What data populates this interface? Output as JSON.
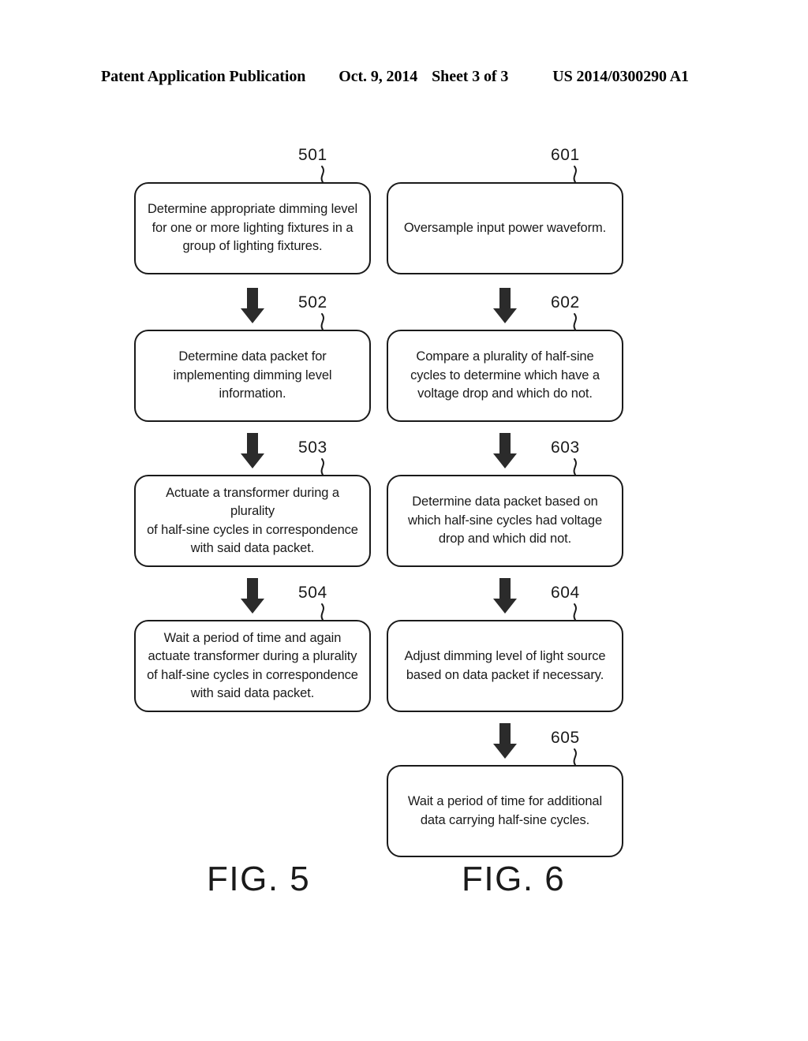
{
  "header": {
    "publication": "Patent Application Publication",
    "date": "Oct. 9, 2014",
    "sheet": "Sheet 3 of 3",
    "doc_number": "US 2014/0300290 A1"
  },
  "figures": [
    {
      "caption": "FIG. 5",
      "steps": [
        {
          "ref": "501",
          "text": "Determine appropriate dimming level\nfor one or more lighting fixtures in a\ngroup of lighting fixtures."
        },
        {
          "ref": "502",
          "text": "Determine data packet for\nimplementing dimming level\ninformation."
        },
        {
          "ref": "503",
          "text": "Actuate a transformer during a plurality\nof half-sine cycles in correspondence\nwith said data packet."
        },
        {
          "ref": "504",
          "text": "Wait a period of time and again\nactuate transformer during a plurality\nof half-sine cycles in correspondence\nwith said data packet."
        }
      ]
    },
    {
      "caption": "FIG. 6",
      "steps": [
        {
          "ref": "601",
          "text": "Oversample input power waveform."
        },
        {
          "ref": "602",
          "text": "Compare a plurality of half-sine\ncycles to determine which have a\nvoltage drop and which do not."
        },
        {
          "ref": "603",
          "text": "Determine data packet based on\nwhich half-sine cycles had voltage\ndrop and which did not."
        },
        {
          "ref": "604",
          "text": "Adjust dimming level of light source\nbased on data packet if necessary."
        },
        {
          "ref": "605",
          "text": "Wait a period of time for additional\ndata carrying half-sine cycles."
        }
      ]
    }
  ],
  "colors": {
    "ink": "#1a1a1a",
    "paper": "#ffffff"
  }
}
